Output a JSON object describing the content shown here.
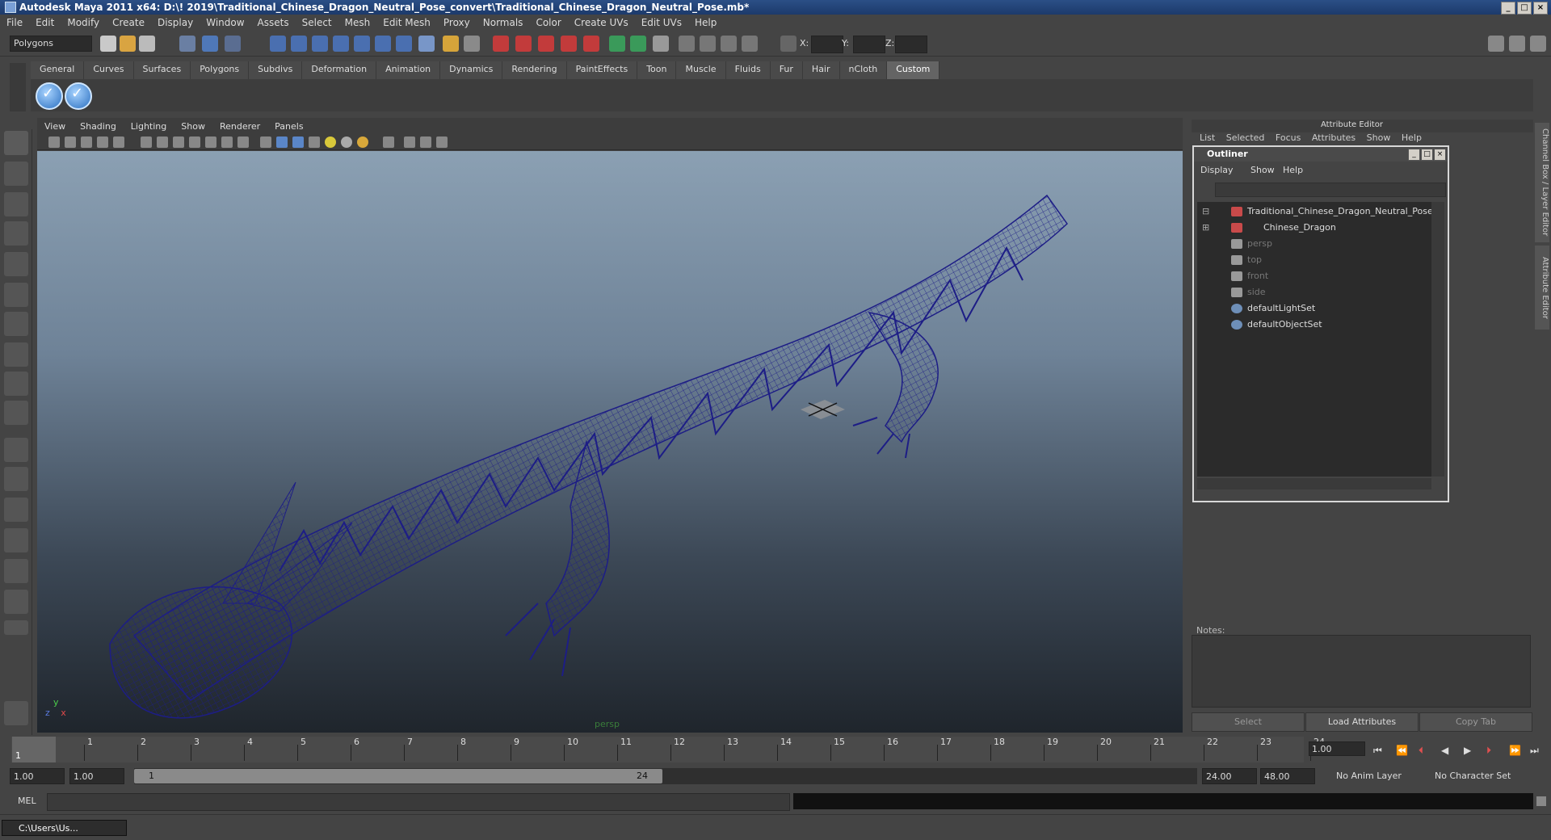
{
  "window": {
    "title": "Autodesk Maya 2011 x64: D:\\! 2019\\Traditional_Chinese_Dragon_Neutral_Pose_convert\\Traditional_Chinese_Dragon_Neutral_Pose.mb*"
  },
  "menubar": [
    "File",
    "Edit",
    "Modify",
    "Create",
    "Display",
    "Window",
    "Assets",
    "Select",
    "Mesh",
    "Edit Mesh",
    "Proxy",
    "Normals",
    "Color",
    "Create UVs",
    "Edit UVs",
    "Help"
  ],
  "statusline": {
    "mode": "Polygons",
    "x_label": "X:",
    "y_label": "Y:",
    "z_label": "Z:"
  },
  "shelf": {
    "tabs": [
      "General",
      "Curves",
      "Surfaces",
      "Polygons",
      "Subdivs",
      "Deformation",
      "Animation",
      "Dynamics",
      "Rendering",
      "PaintEffects",
      "Toon",
      "Muscle",
      "Fluids",
      "Fur",
      "Hair",
      "nCloth",
      "Custom"
    ],
    "active": "Custom"
  },
  "viewport": {
    "menu": [
      "View",
      "Shading",
      "Lighting",
      "Show",
      "Renderer",
      "Panels"
    ],
    "camera": "persp",
    "axis_x": "x",
    "axis_y": "y",
    "axis_z": "z"
  },
  "attribute_editor": {
    "title": "Attribute Editor",
    "menu": [
      "List",
      "Selected",
      "Focus",
      "Attributes",
      "Show",
      "Help"
    ],
    "notes_label": "Notes:",
    "buttons": [
      "Select",
      "Load Attributes",
      "Copy Tab"
    ]
  },
  "side_tabs": [
    "Channel Box / Layer Editor",
    "Attribute Editor"
  ],
  "outliner": {
    "title": "Outliner",
    "menu": [
      "Display",
      "Show",
      "Help"
    ],
    "items": [
      {
        "label": "Traditional_Chinese_Dragon_Neutral_Pose",
        "icon": "transform-icon",
        "dim": false
      },
      {
        "label": "Chinese_Dragon",
        "icon": "transform-icon",
        "dim": false
      },
      {
        "label": "persp",
        "icon": "camera-icon",
        "dim": true
      },
      {
        "label": "top",
        "icon": "camera-icon",
        "dim": true
      },
      {
        "label": "front",
        "icon": "camera-icon",
        "dim": true
      },
      {
        "label": "side",
        "icon": "camera-icon",
        "dim": true
      },
      {
        "label": "defaultLightSet",
        "icon": "set-icon",
        "dim": false
      },
      {
        "label": "defaultObjectSet",
        "icon": "set-icon",
        "dim": false
      }
    ]
  },
  "timeslider": {
    "ticks": [
      "1",
      "2",
      "3",
      "4",
      "5",
      "6",
      "7",
      "8",
      "9",
      "10",
      "11",
      "12",
      "13",
      "14",
      "15",
      "16",
      "17",
      "18",
      "19",
      "20",
      "21",
      "22",
      "23",
      "24"
    ],
    "current_frame": "1",
    "current_frame_field": "1.00"
  },
  "range": {
    "start": "1.00",
    "playback_start": "1.00",
    "slider_start": "1",
    "slider_end": "24",
    "playback_end": "24.00",
    "end": "48.00",
    "anim_layer": "No Anim Layer",
    "character_set": "No Character Set"
  },
  "commandline": {
    "label": "MEL"
  },
  "taskbar": {
    "item": "C:\\Users\\Us..."
  },
  "colors": {
    "wireframe": "#1d1d86",
    "accent": "#2b4f86"
  }
}
